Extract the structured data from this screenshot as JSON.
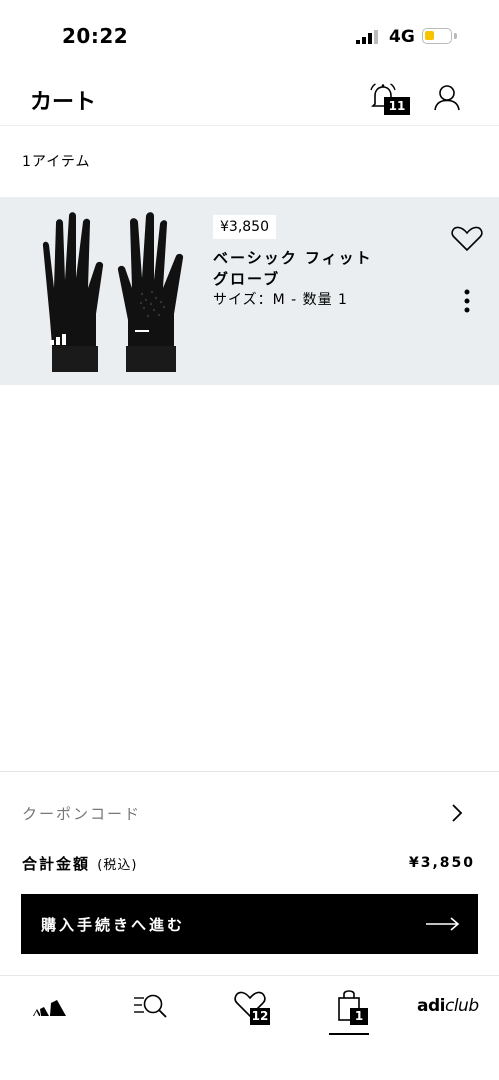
{
  "status_bar": {
    "time": "20:22",
    "network": "4G",
    "battery_level": 0.3
  },
  "header": {
    "title": "カート",
    "notification_count": "11"
  },
  "cart": {
    "item_count_text": "1アイテム"
  },
  "product": {
    "price": "¥3,850",
    "name_line1": "ベーシック フィット",
    "name_line2": "グローブ",
    "meta": "サイズ：M - 数量 1"
  },
  "summary": {
    "coupon_label": "クーポンコード",
    "total_label": "合計金額",
    "total_tax_note": "(税込)",
    "total_value": "¥3,850",
    "checkout_label": "購入手続きへ進む"
  },
  "tab_bar": {
    "wishlist_count": "12",
    "bag_count": "1",
    "club_label_bold": "adi",
    "club_label_italic": "club"
  },
  "icons": [
    "signal-icon",
    "battery-icon",
    "bell-icon",
    "account-icon",
    "heart-icon",
    "more-icon",
    "chevron-right-icon",
    "arrow-right-icon",
    "adidas-logo-icon",
    "search-icon",
    "wishlist-icon",
    "bag-icon"
  ]
}
